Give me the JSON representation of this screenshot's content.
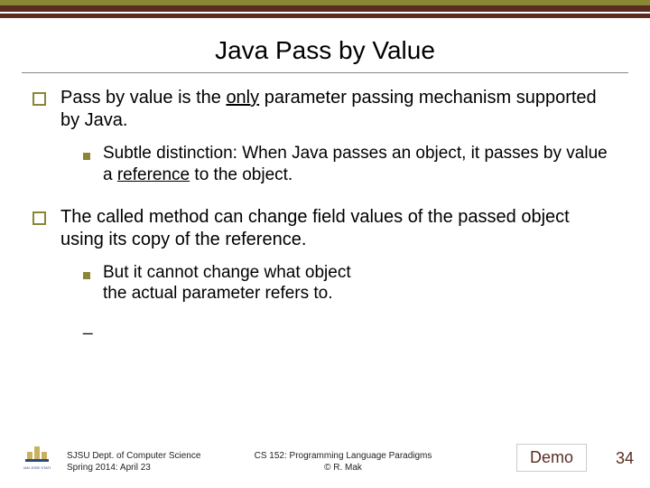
{
  "title": "Java Pass by Value",
  "bullets": [
    {
      "pre": "Pass by value is the ",
      "underlined": "only",
      "post": " parameter passing mechanism supported by Java.",
      "sub": {
        "pre": "Subtle distinction: When Java passes an object, it passes by value a ",
        "underlined": "reference",
        "post": " to the object."
      }
    },
    {
      "text": "The called method can change field values of the passed object using its copy of the reference.",
      "sub": {
        "line1": "But it cannot change what object",
        "line2": "the actual parameter refers to."
      },
      "dash": "_"
    }
  ],
  "footer": {
    "dept_line1": "SJSU Dept. of Computer Science",
    "dept_line2": "Spring 2014: April 23",
    "course_line1": "CS 152: Programming Language Paradigms",
    "course_line2": "© R. Mak",
    "demo": "Demo",
    "page": "34"
  }
}
